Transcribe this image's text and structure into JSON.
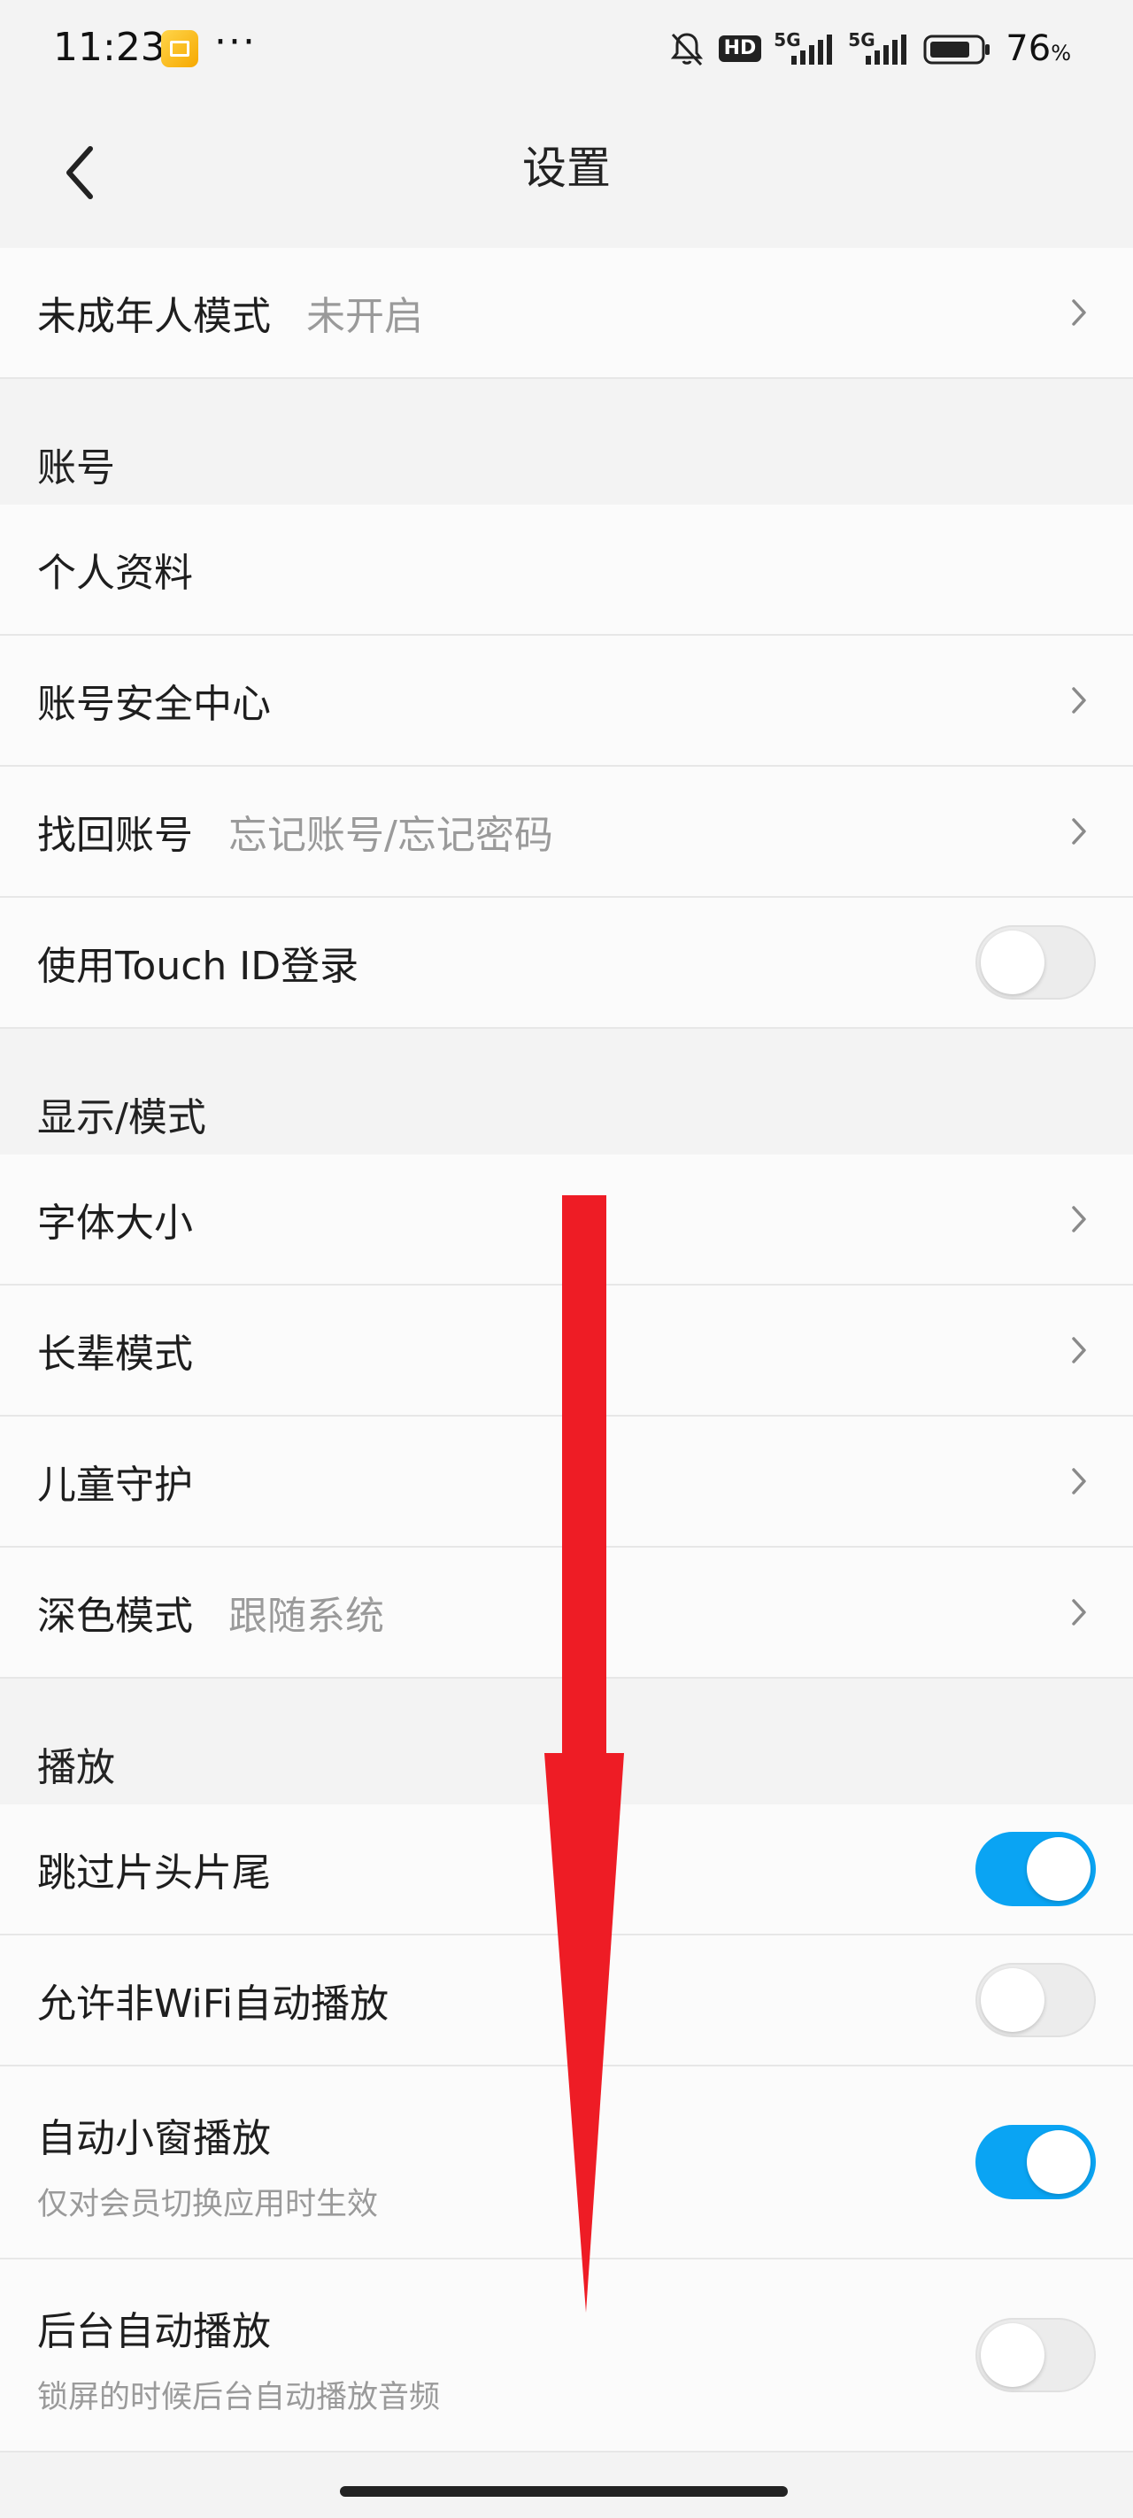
{
  "status_bar": {
    "time": "11:23",
    "hd_label": "HD",
    "net1": "5G",
    "net2": "5G",
    "battery_pct": "76",
    "battery_unit": "%"
  },
  "header": {
    "title": "设置"
  },
  "rows": {
    "minor_mode": {
      "label": "未成年人模式",
      "value": "未开启"
    },
    "section_account": "账号",
    "profile": {
      "label": "个人资料"
    },
    "account_security": {
      "label": "账号安全中心"
    },
    "recover_account": {
      "label": "找回账号",
      "value": "忘记账号/忘记密码"
    },
    "touch_id": {
      "label": "使用Touch ID登录",
      "on": false
    },
    "section_display": "显示/模式",
    "font_size": {
      "label": "字体大小"
    },
    "elder_mode": {
      "label": "长辈模式"
    },
    "child_guard": {
      "label": "儿童守护"
    },
    "dark_mode": {
      "label": "深色模式",
      "value": "跟随系统"
    },
    "section_play": "播放",
    "skip_intro": {
      "label": "跳过片头片尾",
      "on": true
    },
    "non_wifi_autoplay": {
      "label": "允许非WiFi自动播放",
      "on": false
    },
    "auto_pip": {
      "label": "自动小窗播放",
      "sub": "仅对会员切换应用时生效",
      "on": true
    },
    "background_play": {
      "label": "后台自动播放",
      "sub": "锁屏的时候后台自动播放音频",
      "on": false
    }
  },
  "colors": {
    "accent": "#0aa4f3",
    "overlay_arrow": "#ee1c25"
  }
}
